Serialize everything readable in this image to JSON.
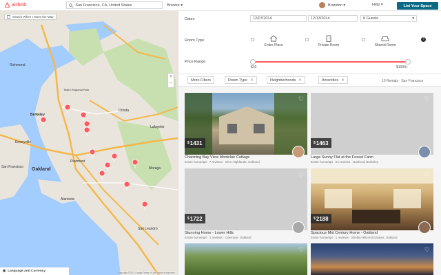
{
  "header": {
    "logo_text": "airbnb",
    "search_value": "San Francisco, CA, United States",
    "browse_label": "Browse",
    "user_name": "Brandon",
    "help_label": "Help",
    "list_space_label": "List Your Space",
    "brand_color": "#ff5a5f",
    "accent_color": "#0a6a85"
  },
  "map": {
    "search_when_move_label": "Search When I Move the Map",
    "language_label": "Language and Currency",
    "credit": "Map data ©2014 Google  Terms of Use  Report a map error",
    "zoom_in": "+",
    "zoom_out": "−",
    "place_labels": [
      "Richmond",
      "Berkeley",
      "Orinda",
      "Lafayette",
      "Emeryville",
      "Oakland",
      "Piedmont",
      "Alameda",
      "San Leandro",
      "San Francisco",
      "Moraga",
      "Tilden Regional Park"
    ],
    "pins_count": 12
  },
  "filters": {
    "dates_label": "Dates",
    "checkin": "12/07/2014",
    "checkout": "12/13/2014",
    "guests": "8 Guests",
    "room_type_label": "Room Type",
    "room_types": [
      "Entire Place",
      "Private Room",
      "Shared Room"
    ],
    "price_range_label": "Price Range",
    "price_min": "$10",
    "price_max": "$1000+",
    "help_icon": "?"
  },
  "chips": {
    "more_filters": "More Filters",
    "room_type": "Room Type",
    "neighborhoods": "Neighborhoods",
    "amenities": "Amenities",
    "result_count": "10 Rentals · San Francisco"
  },
  "listings": [
    {
      "price": "1431",
      "title": "Charming Bay View Montclair Cottage",
      "subtitle": "Entire home/apt · 7 reviews · Glen Highlands, Oakland"
    },
    {
      "price": "1463",
      "title": "Large Sunny Flat at the Fossel Farm",
      "subtitle": "Entire home/apt · 24 reviews · Bushrod, Berkeley"
    },
    {
      "price": "1722",
      "title": "Stunning Home - Lower Hills",
      "subtitle": "Entire home/apt · 1 reviews · Oakmore, Oakland"
    },
    {
      "price": "2188",
      "title": "Spacious Mid Century Home - Oakland",
      "subtitle": "Entire home/apt · 1 reviews · Shelby-Hillcrest Estates, Oakland"
    },
    {
      "price": "",
      "title": "",
      "subtitle": ""
    },
    {
      "price": "",
      "title": "",
      "subtitle": ""
    }
  ],
  "currency_symbol": "$"
}
